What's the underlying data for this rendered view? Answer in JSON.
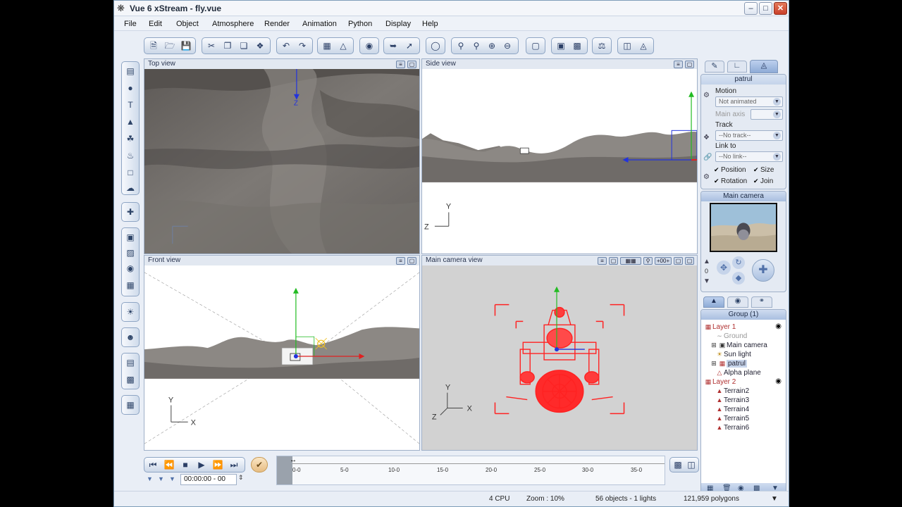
{
  "window": {
    "title": "Vue 6 xStream - fly.vue"
  },
  "menu": [
    "File",
    "Edit",
    "Object",
    "Atmosphere",
    "Render",
    "Animation",
    "Python",
    "Display",
    "Help"
  ],
  "viewports": {
    "top": {
      "title": "Top view",
      "axis_z": "Z"
    },
    "side": {
      "title": "Side view",
      "axis_y": "Y",
      "axis_z": "Z"
    },
    "front": {
      "title": "Front view",
      "axis_y": "Y",
      "axis_x": "X"
    },
    "camera": {
      "title": "Main camera view",
      "axis_y": "Y",
      "axis_x": "X",
      "axis_z": "Z",
      "zoom_label": "+00+"
    }
  },
  "properties": {
    "object_name": "patrul",
    "motion_label": "Motion",
    "motion_value": "Not animated",
    "main_axis_label": "Main axis",
    "track_label": "Track",
    "track_value": "--No track--",
    "link_label": "Link to",
    "link_value": "--No link--",
    "checks": {
      "position": "Position",
      "size": "Size",
      "rotation": "Rotation",
      "join": "Join"
    }
  },
  "camera_panel": {
    "title": "Main camera",
    "zoom_value": "0"
  },
  "scene": {
    "group_title": "Group (1)",
    "layer1": "Layer 1",
    "layer1_items": [
      "Ground",
      "Main camera",
      "Sun light",
      "patrul",
      "Alpha plane"
    ],
    "layer2": "Layer 2",
    "layer2_items": [
      "Terrain2",
      "Terrain3",
      "Terrain4",
      "Terrain5",
      "Terrain6"
    ]
  },
  "timeline": {
    "time": "00:00:00 - 00",
    "ticks": [
      "0-0",
      "5-0",
      "10-0",
      "15-0",
      "20-0",
      "25-0",
      "30-0",
      "35-0"
    ]
  },
  "status": {
    "cpu": "4 CPU",
    "zoom": "Zoom : 10%",
    "objects": "56 objects - 1 lights",
    "polygons": "121,959 polygons"
  },
  "colors": {
    "axis_green": "#22bb22",
    "axis_red": "#e02020",
    "axis_blue": "#2233dd",
    "selection_red": "#ff2222"
  }
}
